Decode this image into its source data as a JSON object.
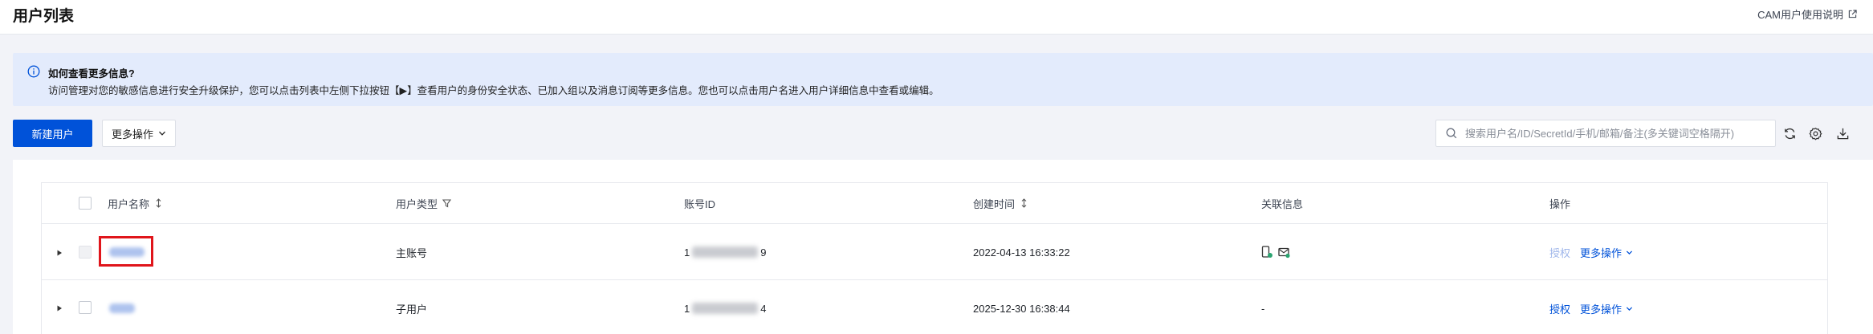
{
  "header": {
    "title": "用户列表",
    "doc_link": "CAM用户使用说明"
  },
  "banner": {
    "title": "如何查看更多信息?",
    "text": "访问管理对您的敏感信息进行安全升级保护，您可以点击列表中左侧下拉按钮【▶】查看用户的身份安全状态、已加入组以及消息订阅等更多信息。您也可以点击用户名进入用户详细信息中查看或编辑。"
  },
  "toolbar": {
    "create_user": "新建用户",
    "more_actions": "更多操作",
    "search_placeholder": "搜索用户名/ID/SecretId/手机/邮箱/备注(多关键词空格隔开)"
  },
  "table": {
    "columns": {
      "username": "用户名称",
      "user_type": "用户类型",
      "account_id": "账号ID",
      "created_at": "创建时间",
      "associated_info": "关联信息",
      "actions": "操作"
    },
    "rows": [
      {
        "user_type": "主账号",
        "account_id_prefix": "1",
        "account_id_suffix": "9",
        "created_at": "2022-04-13 16:33:22",
        "associated_info": "",
        "authorize": "授权",
        "more": "更多操作"
      },
      {
        "user_type": "子用户",
        "account_id_prefix": "1",
        "account_id_suffix": "4",
        "created_at": "2025-12-30 16:38:44",
        "associated_info": "-",
        "authorize": "授权",
        "more": "更多操作"
      }
    ]
  },
  "icons": {
    "info": "info-circle-icon",
    "external": "external-link-icon",
    "search": "search-icon",
    "refresh": "refresh-icon",
    "settings": "gear-icon",
    "download": "download-icon",
    "sort": "sort-icon",
    "filter": "filter-icon",
    "phone": "phone-verified-icon",
    "mail": "mail-verified-icon"
  },
  "colors": {
    "primary": "#0052d9",
    "banner_bg": "#e3ebfc",
    "highlight": "#e0151b",
    "verified": "#2ba471"
  }
}
